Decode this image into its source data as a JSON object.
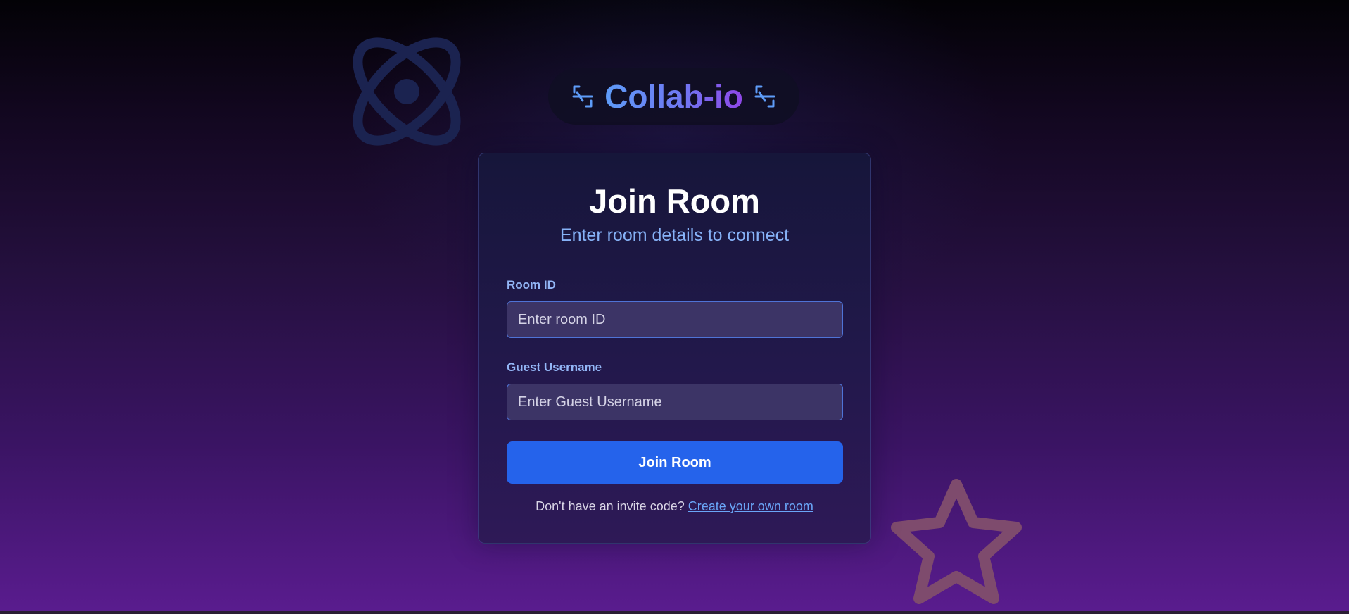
{
  "brand": {
    "title": "Collab-io",
    "left_icon": "code-brackets-icon",
    "right_icon": "code-brackets-icon"
  },
  "decorations": {
    "atom": "atom-icon",
    "star": "star-icon"
  },
  "card": {
    "title": "Join Room",
    "subtitle": "Enter room details to connect"
  },
  "form": {
    "room_id": {
      "label": "Room ID",
      "placeholder": "Enter room ID",
      "value": ""
    },
    "guest_username": {
      "label": "Guest Username",
      "placeholder": "Enter Guest Username",
      "value": ""
    },
    "submit_label": "Join Room"
  },
  "footer": {
    "prompt": "Don't have an invite code?",
    "link_text": "Create your own room"
  },
  "colors": {
    "accent": "#2563eb",
    "label": "#93b6f6",
    "subtitle": "#86b2f7",
    "link": "#6aa6f8",
    "brand_gradient_start": "#5e9cf8",
    "brand_gradient_end": "#8f47e8"
  }
}
